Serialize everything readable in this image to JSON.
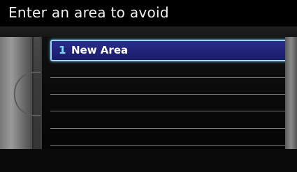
{
  "screen": {
    "title": "Enter an area to avoid"
  },
  "list": {
    "items": [
      {
        "number": "1",
        "label": "New Area"
      }
    ]
  },
  "colors": {
    "title_bg": "#000000",
    "selection_fill": "#23257a",
    "selection_border": "#9fd8f2",
    "item_number": "#7fe0ff",
    "item_label": "#ffffff"
  }
}
